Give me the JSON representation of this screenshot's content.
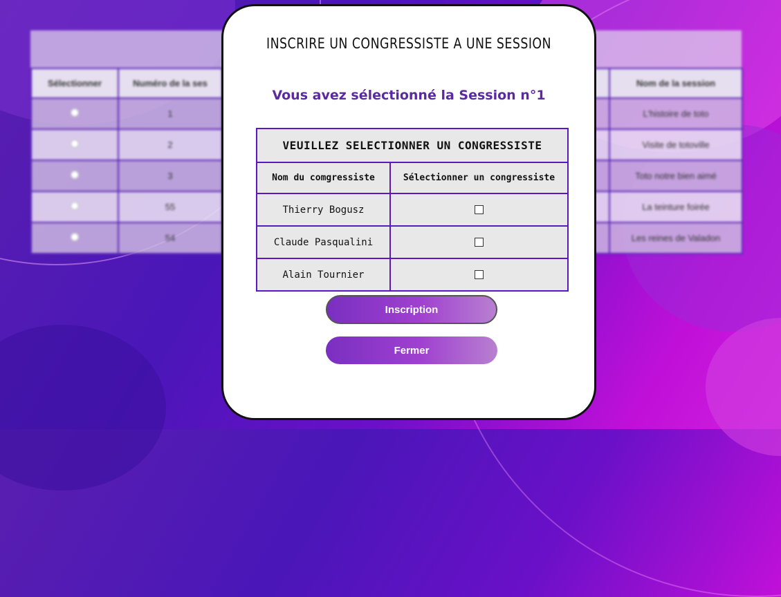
{
  "modal": {
    "title": "INSCRIRE UN CONGRESSISTE A UNE SESSION",
    "subtitle": "Vous avez sélectionné la Session n°1",
    "table_title": "VEUILLEZ SELECTIONNER UN CONGRESSISTE",
    "columns": [
      "Nom du comgressiste",
      "Sélectionner un congressiste"
    ],
    "rows": [
      {
        "name": "Thierry Bogusz"
      },
      {
        "name": "Claude Pasqualini"
      },
      {
        "name": "Alain Tournier"
      }
    ],
    "inscription_label": "Inscription",
    "close_label": "Fermer"
  },
  "background_table": {
    "headers": [
      "Sélectionner",
      "Numéro de la ses",
      "",
      "",
      "",
      "Nom de la session"
    ],
    "rows": [
      {
        "num": "1",
        "name": "L'histoire de toto"
      },
      {
        "num": "2",
        "name": "Visite de totoville"
      },
      {
        "num": "3",
        "name": "Toto notre bien aimé"
      },
      {
        "num": "55",
        "name": "La teinture foirée"
      },
      {
        "num": "54",
        "name": "Les reines de Valadon"
      }
    ]
  },
  "colors": {
    "accent": "#5b2aa0",
    "table_border": "#5a18c0",
    "button_gradient_start": "#7a2fc0",
    "button_gradient_end": "#b880d0"
  }
}
